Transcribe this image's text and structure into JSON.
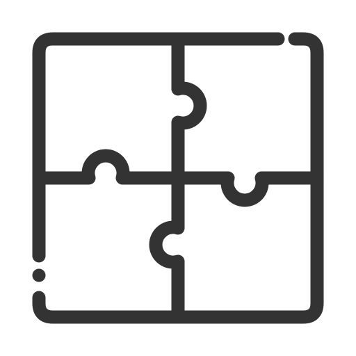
{
  "icon": {
    "name": "puzzle-icon",
    "stroke_color": "#333333",
    "background_color": "#ffffff"
  }
}
